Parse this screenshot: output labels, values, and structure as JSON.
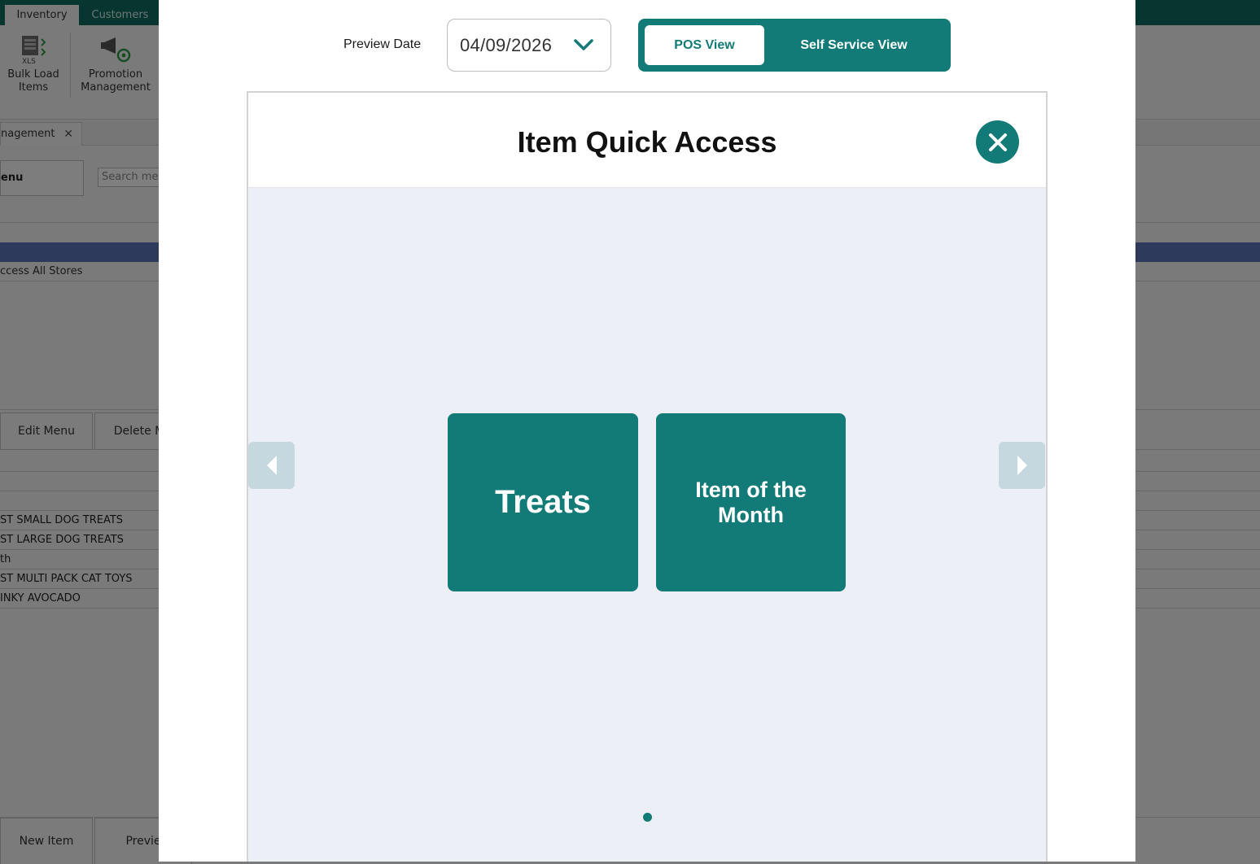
{
  "background": {
    "ribbon_tabs": [
      "Inventory",
      "Customers"
    ],
    "ribbon_buttons": [
      {
        "label_line1": "Bulk Load",
        "label_line2": "Items",
        "icon": "xls-bulk-load-icon"
      },
      {
        "label_line1": "Promotion",
        "label_line2": "Management",
        "icon": "megaphone-gear-icon"
      }
    ],
    "doc_tab": "nagement",
    "menu_button": "enu",
    "search_placeholder": "Search men",
    "store_text": "ccess All Stores",
    "edit_menu": "Edit Menu",
    "delete_menu": "Delete M",
    "grid_rows": [
      "",
      "",
      "",
      "ST SMALL DOG TREATS",
      "ST LARGE DOG TREATS",
      "th",
      "ST MULTI PACK CAT TOYS",
      "INKY AVOCADO"
    ],
    "new_item": "New Item",
    "preview": "Previe"
  },
  "modal": {
    "preview_date_label": "Preview Date",
    "preview_date_value": "04/09/2026",
    "view_toggle": {
      "pos_label": "POS View",
      "self_service_label": "Self Service View",
      "selected": "POS View"
    },
    "title": "Item Quick Access",
    "tiles": [
      {
        "label": "Treats"
      },
      {
        "label": "Item of the Month"
      }
    ],
    "page_count": 1,
    "current_page": 1
  },
  "colors": {
    "teal": "#127b77",
    "arrow_bg": "#c5d7df",
    "canvas_bg": "#eceff6"
  }
}
